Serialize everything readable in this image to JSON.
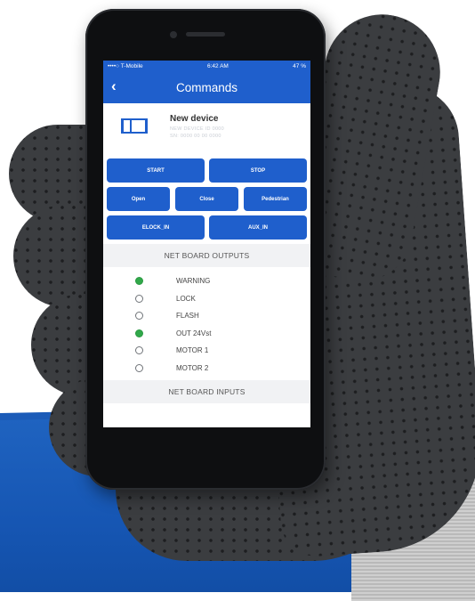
{
  "status_bar": {
    "carrier": "••••○ T-Mobile",
    "time": "6:42 AM",
    "battery": "47 %"
  },
  "header": {
    "title": "Commands",
    "back_icon": "chevron-left-icon"
  },
  "device": {
    "name": "New device",
    "sub1": "NEW DEVICE ID 0000",
    "sub2": "SN: 0000 00 00 0000"
  },
  "buttons": {
    "start": "START",
    "stop": "STOP",
    "open": "Open",
    "close": "Close",
    "pedestrian": "Pedestrian",
    "elock_in": "ELOCK_IN",
    "aux_in": "AUX_IN"
  },
  "outputs": {
    "title": "NET BOARD OUTPUTS",
    "items": [
      {
        "label": "WARNING",
        "active": true
      },
      {
        "label": "LOCK",
        "active": false
      },
      {
        "label": "FLASH",
        "active": false
      },
      {
        "label": "OUT 24Vst",
        "active": true
      },
      {
        "label": "MOTOR 1",
        "active": false
      },
      {
        "label": "MOTOR 2",
        "active": false
      }
    ]
  },
  "inputs": {
    "title": "NET BOARD INPUTS"
  },
  "colors": {
    "accent": "#1f5fcc",
    "active_dot": "#31a84a",
    "band": "#1656b3"
  }
}
